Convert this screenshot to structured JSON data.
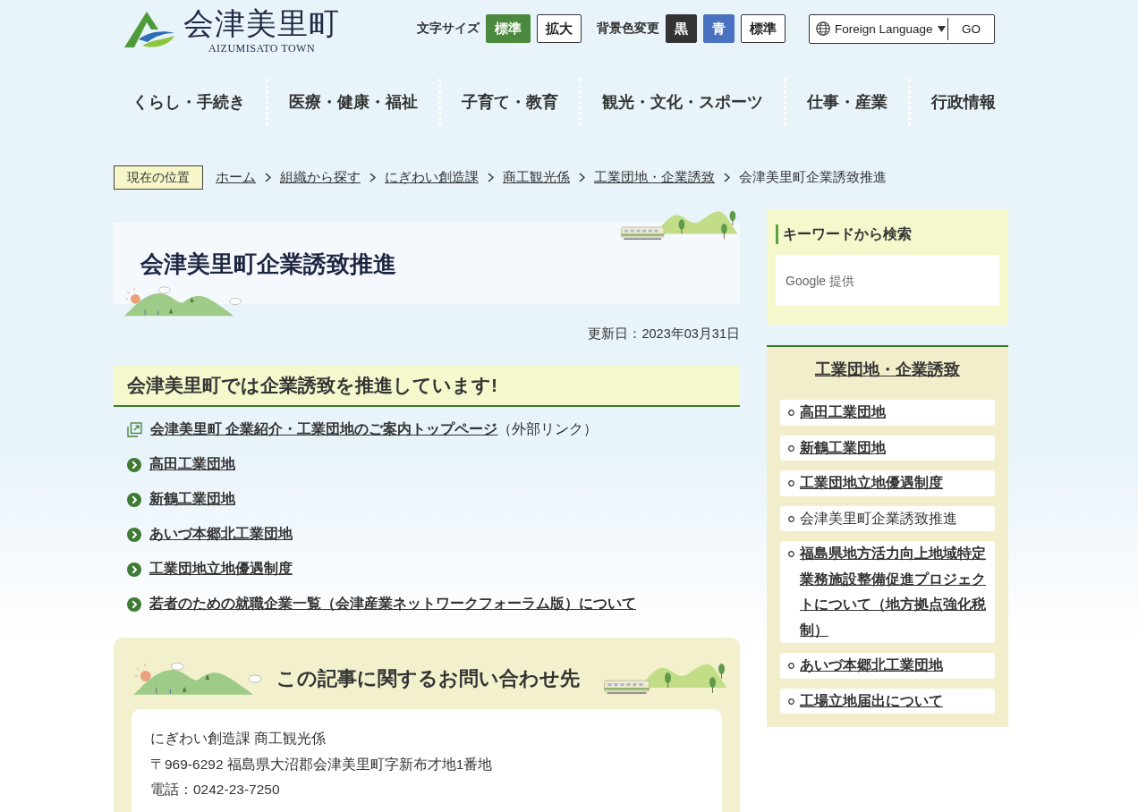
{
  "header": {
    "logo_title": "会津美里町",
    "logo_subtitle": "AIZUMISATO TOWN",
    "text_size": {
      "label": "文字サイズ",
      "options": [
        {
          "label": "標準",
          "selected": true
        },
        {
          "label": "拡大",
          "selected": false
        }
      ]
    },
    "bg_color": {
      "label": "背景色変更",
      "options": [
        {
          "label": "黒",
          "color": "#333333"
        },
        {
          "label": "青",
          "color": "#4a72c0"
        },
        {
          "label": "標準",
          "color": "#ffffff"
        }
      ]
    },
    "language": {
      "value": "Foreign Language",
      "button": "GO"
    }
  },
  "nav": [
    "くらし・手続き",
    "医療・健康・福祉",
    "子育て・教育",
    "観光・文化・スポーツ",
    "仕事・産業",
    "行政情報"
  ],
  "breadcrumb": {
    "label": "現在の位置",
    "items": [
      {
        "label": "ホーム",
        "current": false
      },
      {
        "label": "組織から探す",
        "current": false
      },
      {
        "label": "にぎわい創造課",
        "current": false
      },
      {
        "label": "商工観光係",
        "current": false
      },
      {
        "label": "工業団地・企業誘致",
        "current": false
      },
      {
        "label": "会津美里町企業誘致推進",
        "current": true
      }
    ]
  },
  "page": {
    "title": "会津美里町企業誘致推進",
    "updated": "更新日：2023年03月31日"
  },
  "section": {
    "heading": "会津美里町では企業誘致を推進しています!",
    "links": [
      {
        "kind": "external",
        "label": "会津美里町 企業紹介・工業団地のご案内トップページ",
        "note": "（外部リンク）"
      },
      {
        "kind": "internal",
        "label": "高田工業団地"
      },
      {
        "kind": "internal",
        "label": "新鶴工業団地"
      },
      {
        "kind": "internal",
        "label": "あいづ本郷北工業団地"
      },
      {
        "kind": "internal",
        "label": "工業団地立地優遇制度"
      },
      {
        "kind": "internal",
        "label": "若者のための就職企業一覧（会津産業ネットワークフォーラム版）について"
      }
    ]
  },
  "contact": {
    "heading": "この記事に関するお問い合わせ先",
    "lines": [
      "にぎわい創造課 商工観光係",
      "〒969-6292 福島県大沼郡会津美里町字新布才地1番地",
      "電話：0242-23-7250"
    ]
  },
  "sidebar": {
    "search": {
      "heading": "キーワードから検索",
      "placeholder": "Google 提供"
    },
    "menu": {
      "heading": "工業団地・企業誘致",
      "items": [
        {
          "label": "高田工業団地",
          "selected": false
        },
        {
          "label": "新鶴工業団地",
          "selected": false
        },
        {
          "label": "工業団地立地優遇制度",
          "selected": false
        },
        {
          "label": "会津美里町企業誘致推進",
          "selected": true
        },
        {
          "label": "福島県地方活力向上地域特定業務施設整備促進プロジェクトについて（地方拠点強化税制）",
          "selected": false
        },
        {
          "label": "あいづ本郷北工業団地",
          "selected": false
        },
        {
          "label": "工場立地届出について",
          "selected": false
        }
      ]
    }
  }
}
